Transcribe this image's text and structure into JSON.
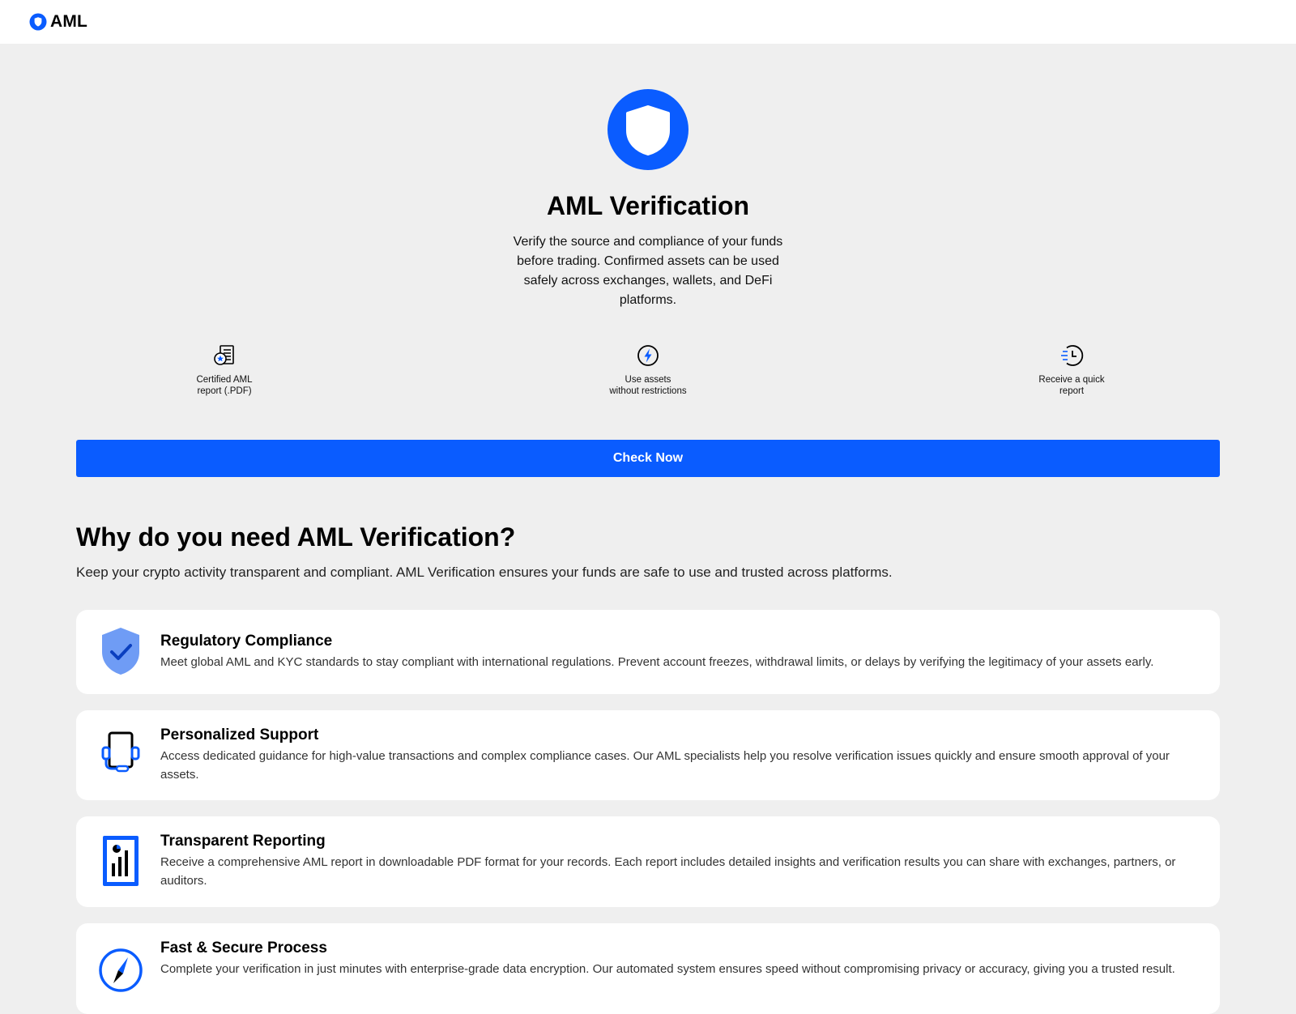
{
  "header": {
    "brand_text": "AML",
    "brand_icon": "shield-logo-icon"
  },
  "colors": {
    "accent": "#0a5cff",
    "background": "#efefef",
    "card": "#ffffff"
  },
  "hero": {
    "icon": "shield-icon",
    "title": "AML Verification",
    "description": "Verify the source and compliance of your funds before trading. Confirmed assets can be used safely across exchanges, wallets, and DeFi platforms."
  },
  "features": [
    {
      "icon": "certificate-report-icon",
      "label": "Certified AML\nreport (.PDF)"
    },
    {
      "icon": "lightning-icon",
      "label": "Use assets\nwithout restrictions"
    },
    {
      "icon": "fast-clock-icon",
      "label": "Receive a quick\nreport"
    }
  ],
  "cta": {
    "label": "Check Now"
  },
  "why": {
    "title": "Why do you need AML Verification?",
    "description": "Keep your crypto activity transparent and compliant. AML Verification ensures your funds are safe to use and trusted across platforms.",
    "cards": [
      {
        "icon": "shield-check-icon",
        "title": "Regulatory Compliance",
        "text": "Meet global AML and KYC standards to stay compliant with international regulations. Prevent account freezes, withdrawal limits, or delays by verifying the legitimacy of your assets early."
      },
      {
        "icon": "headset-support-icon",
        "title": "Personalized Support",
        "text": "Access dedicated guidance for high-value transactions and complex compliance cases. Our AML specialists help you resolve verification issues quickly and ensure smooth approval of your assets."
      },
      {
        "icon": "report-chart-icon",
        "title": "Transparent Reporting",
        "text": "Receive a comprehensive AML report in downloadable PDF format for your records. Each report includes detailed insights and verification results you can share with exchanges, partners, or auditors."
      },
      {
        "icon": "compass-icon",
        "title": "Fast & Secure Process",
        "text": "Complete your verification in just minutes with enterprise-grade data encryption. Our automated system ensures speed without compromising privacy or accuracy, giving you a trusted result."
      }
    ]
  }
}
